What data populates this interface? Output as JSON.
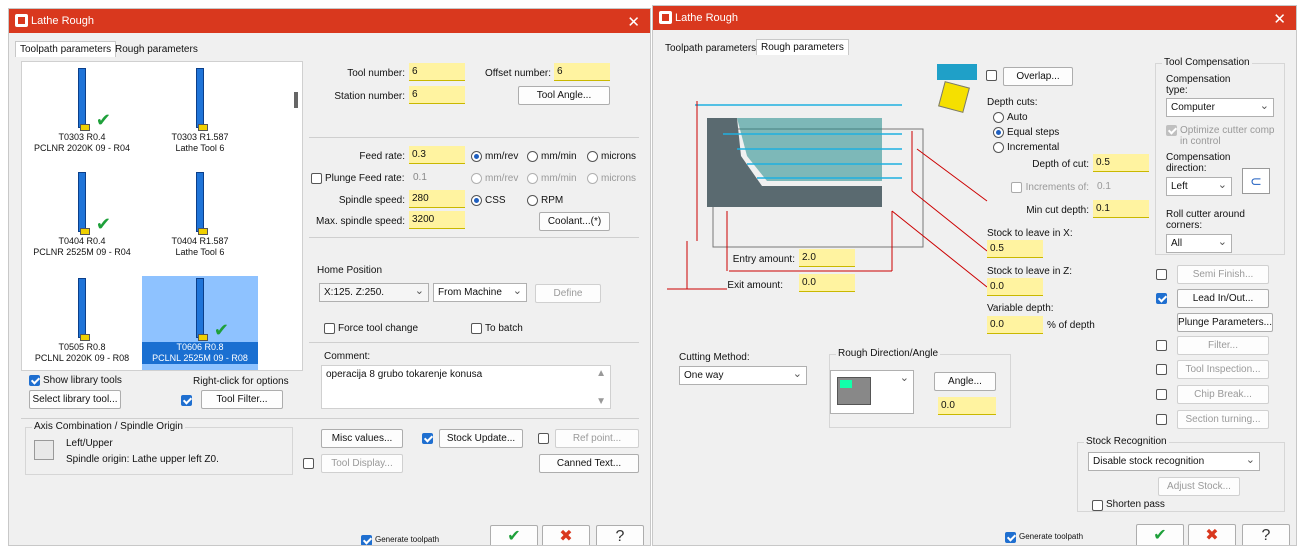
{
  "left": {
    "title": "Lathe Rough",
    "tabs": [
      "Toolpath parameters",
      "Rough parameters"
    ],
    "tools": [
      {
        "name": "T0303 R0.4",
        "desc": "PCLNR 2020K 09 - R04",
        "check": true
      },
      {
        "name": "T0303 R1.587",
        "desc": "Lathe Tool 6",
        "check": false
      },
      {
        "name": "T0404 R0.4",
        "desc": "PCLNR 2525M 09 - R04",
        "check": true
      },
      {
        "name": "T0404 R1.587",
        "desc": "Lathe Tool 6",
        "check": false
      },
      {
        "name": "T0505 R0.8",
        "desc": "PCLNL 2020K 09 - R08",
        "check": false
      },
      {
        "name": "T0606 R0.8",
        "desc": "PCLNL 2525M 09 - R08",
        "check": true
      }
    ],
    "tool_number_label": "Tool number:",
    "tool_number": "6",
    "offset_number_label": "Offset number:",
    "offset_number": "6",
    "station_number_label": "Station number:",
    "station_number": "6",
    "tool_angle_btn": "Tool Angle...",
    "feed_rate_label": "Feed rate:",
    "feed_rate": "0.3",
    "plunge_label": "Plunge Feed rate:",
    "plunge_value": "0.1",
    "spindle_label": "Spindle speed:",
    "spindle": "280",
    "max_spindle_label": "Max. spindle speed:",
    "max_spindle": "3200",
    "units": [
      "mm/rev",
      "mm/min",
      "microns"
    ],
    "css": "CSS",
    "rpm": "RPM",
    "coolant_btn": "Coolant...(*)",
    "home_title": "Home Position",
    "home_value": "X:125. Z:250.",
    "home_select": "From Machine",
    "define_btn": "Define",
    "force_tool_change": "Force tool change",
    "to_batch": "To batch",
    "comment_label": "Comment:",
    "comment": "operacija 8 grubo tokarenje konusa",
    "show_library": "Show library tools",
    "right_click": "Right-click for options",
    "select_library_btn": "Select library tool...",
    "tool_filter_btn": "Tool Filter...",
    "axis_title": "Axis Combination / Spindle Origin",
    "axis_line1": "Left/Upper",
    "axis_line2": "Spindle origin: Lathe upper left  Z0.",
    "misc_btn": "Misc values...",
    "stock_update_btn": "Stock Update...",
    "ref_point_btn": "Ref point...",
    "tool_display_btn": "Tool Display...",
    "canned_text_btn": "Canned Text...",
    "generate": "Generate toolpath"
  },
  "right": {
    "title": "Lathe Rough",
    "tabs": [
      "Toolpath parameters",
      "Rough parameters"
    ],
    "overlap_btn": "Overlap...",
    "depth_cuts": "Depth cuts:",
    "auto": "Auto",
    "equal": "Equal steps",
    "incremental": "Incremental",
    "depth_of_cut_label": "Depth of cut:",
    "depth_of_cut": "0.5",
    "increments_label": "Increments of:",
    "increments": "0.1",
    "min_cut_label": "Min cut depth:",
    "min_cut": "0.1",
    "stock_x_label": "Stock to leave in X:",
    "stock_x": "0.5",
    "stock_z_label": "Stock to leave in Z:",
    "stock_z": "0.0",
    "variable_label": "Variable depth:",
    "variable": "0.0",
    "pct_label": "% of depth",
    "entry_label": "Entry amount:",
    "entry": "2.0",
    "exit_label": "Exit amount:",
    "exit": "0.0",
    "tool_comp_title": "Tool Compensation",
    "comp_type_label": "Compensation type:",
    "comp_type": "Computer",
    "optimize_label": "Optimize cutter comp in control",
    "comp_dir_label": "Compensation direction:",
    "comp_dir": "Left",
    "roll_label": "Roll cutter around corners:",
    "roll": "All",
    "semi_finish_btn": "Semi Finish...",
    "lead_btn": "Lead In/Out...",
    "plunge_btn": "Plunge Parameters...",
    "filter_btn": "Filter...",
    "tool_inspection_btn": "Tool Inspection...",
    "chip_break_btn": "Chip Break...",
    "section_btn": "Section turning...",
    "cutting_method_label": "Cutting Method:",
    "cutting_method": "One way",
    "rough_dir_title": "Rough Direction/Angle",
    "angle_btn": "Angle...",
    "angle": "0.0",
    "stock_rec_title": "Stock Recognition",
    "stock_rec": "Disable stock recognition",
    "adjust_stock_btn": "Adjust Stock...",
    "shorten": "Shorten pass",
    "generate": "Generate toolpath"
  },
  "colors": {
    "title_bar": "#d9381e",
    "field": "#fff3a0",
    "accent": "#1f6fd0"
  }
}
